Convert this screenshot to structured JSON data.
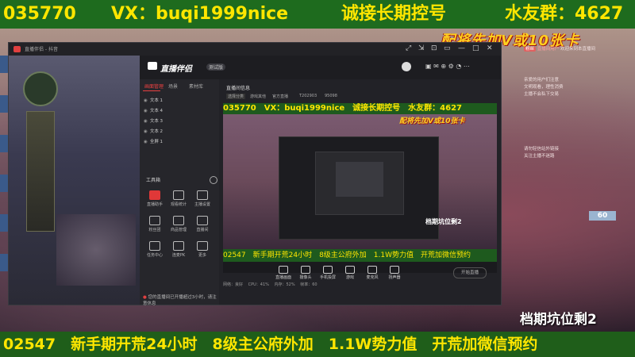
{
  "top_ticker": {
    "part1": "035770",
    "part2": "VX：buqi1999nice",
    "part3": "诚接长期控号",
    "part4": "水友群：4627"
  },
  "banner": "配将先加V或10张卡",
  "bottom_ticker": "02547　新手期开荒24小时　8级主公府外加　1.1W势力值　开荒加微信预约",
  "slot_label": "档期坑位剩2",
  "window": {
    "title": "直播伴侣 - 抖音",
    "controls": [
      "⤢",
      "⇲",
      "⊡",
      "▭",
      "—",
      "□",
      "✕"
    ]
  },
  "app": {
    "logo": "直播伴侣",
    "badge": "测试版",
    "tabs": [
      "画面管理",
      "场景",
      "素材库"
    ],
    "layers": [
      "文本 1",
      "文本 4",
      "文本 3",
      "文本 2",
      "全屏 1"
    ],
    "tools_title": "工具箱",
    "tools": [
      {
        "label": "直播助手"
      },
      {
        "label": "观看统计"
      },
      {
        "label": "主播设置"
      },
      {
        "label": "粉丝团"
      },
      {
        "label": "商品管理"
      },
      {
        "label": "直播间"
      },
      {
        "label": "任务中心"
      },
      {
        "label": "连麦PK"
      },
      {
        "label": "更多"
      }
    ],
    "warning": "您的直播间已开播超过3小时，请注意休息",
    "preview_title": "直播间信息",
    "preview_meta1": "选择分类",
    "preview_meta2": "游戏其他",
    "preview_meta3": "官方直播",
    "preview_meta4": "T202903",
    "preview_meta5": "95098",
    "bottom_tools": [
      "直播画面",
      "摄像头",
      "手机投屏",
      "游戏",
      "麦克风",
      "扬声器"
    ],
    "start_button": "开始直播",
    "status": [
      "网络：良好",
      "CPU：41%",
      "内存：52%",
      "帧率：60"
    ]
  },
  "preview": {
    "ticker": "035770　VX：buqi1999nice　诚接长期控号　水友群：4627",
    "banner": "配将先加V或10张卡",
    "slot": "档期坑位剩2",
    "bottom": "02547　新手期开荒24小时　8级主公府外加　1.1W势力值　开荒加微信预约"
  },
  "chat": {
    "lines": [
      {
        "tag": "粉丝",
        "user": "直播间用户",
        "text": "欢迎来到本直播间"
      },
      {
        "text": "亲爱的用户们注意"
      },
      {
        "text": "文明观看，理性消费"
      },
      {
        "text": "主播不会私下交易"
      },
      {
        "text": "请勿轻信站外链接"
      },
      {
        "text": "关注主播不迷路"
      }
    ]
  },
  "fps": "60"
}
